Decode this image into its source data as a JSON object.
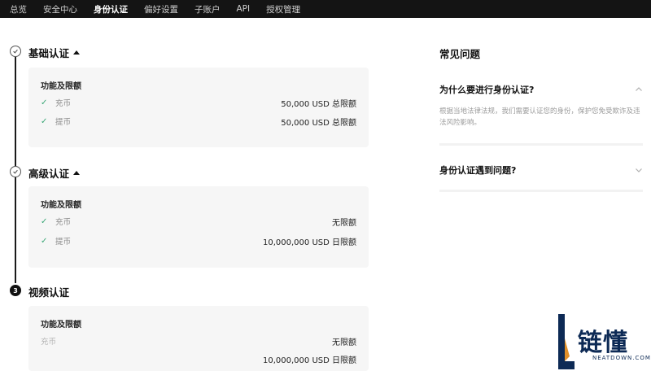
{
  "nav": {
    "items": [
      {
        "label": "总览",
        "active": false
      },
      {
        "label": "安全中心",
        "active": false
      },
      {
        "label": "身份认证",
        "active": true
      },
      {
        "label": "偏好设置",
        "active": false
      },
      {
        "label": "子账户",
        "active": false
      },
      {
        "label": "API",
        "active": false
      },
      {
        "label": "授权管理",
        "active": false
      }
    ]
  },
  "levels": [
    {
      "title": "基础认证",
      "status": "completed",
      "expanded": true,
      "card_header": "功能及限额",
      "rows": [
        {
          "label": "充币",
          "value": "50,000 USD 总限额"
        },
        {
          "label": "提币",
          "value": "50,000 USD 总限额"
        }
      ]
    },
    {
      "title": "高级认证",
      "status": "completed",
      "expanded": true,
      "card_header": "功能及限额",
      "rows": [
        {
          "label": "充币",
          "value": "无限额"
        },
        {
          "label": "提币",
          "value": "10,000,000 USD 日限额"
        }
      ]
    },
    {
      "title": "视频认证",
      "status": "pending",
      "step_number": "3",
      "card_header": "功能及限额",
      "rows": [
        {
          "label": "充币",
          "value": "无限额"
        },
        {
          "label": "",
          "value": "10,000,000 USD 日限额"
        }
      ]
    }
  ],
  "faq": {
    "title": "常见问题",
    "items": [
      {
        "question": "为什么要进行身份认证?",
        "answer": "根据当地法律法规，我们需要认证您的身份，保护您免受欺诈及违法风险影响。",
        "expanded": true
      },
      {
        "question": "身份认证遇到问题?",
        "answer": "",
        "expanded": false
      }
    ]
  },
  "watermark": {
    "text": "链懂",
    "sub": "NEATDOWN.COM"
  },
  "colors": {
    "nav_bg": "#141414",
    "check": "#3aa776",
    "card_bg": "#f6f6f6",
    "watermark": "#0d2a55"
  }
}
